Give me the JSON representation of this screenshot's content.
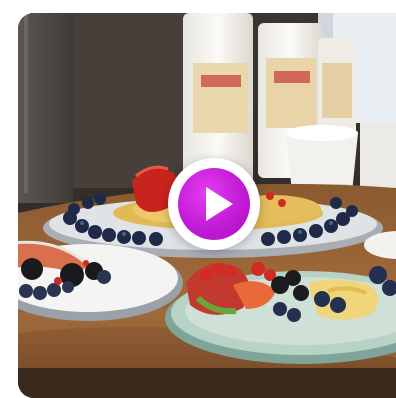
{
  "video": {
    "thumbnail_description_icon": "video-thumbnail",
    "play_icon": "play-icon",
    "accent_color": "#c21bd6"
  }
}
